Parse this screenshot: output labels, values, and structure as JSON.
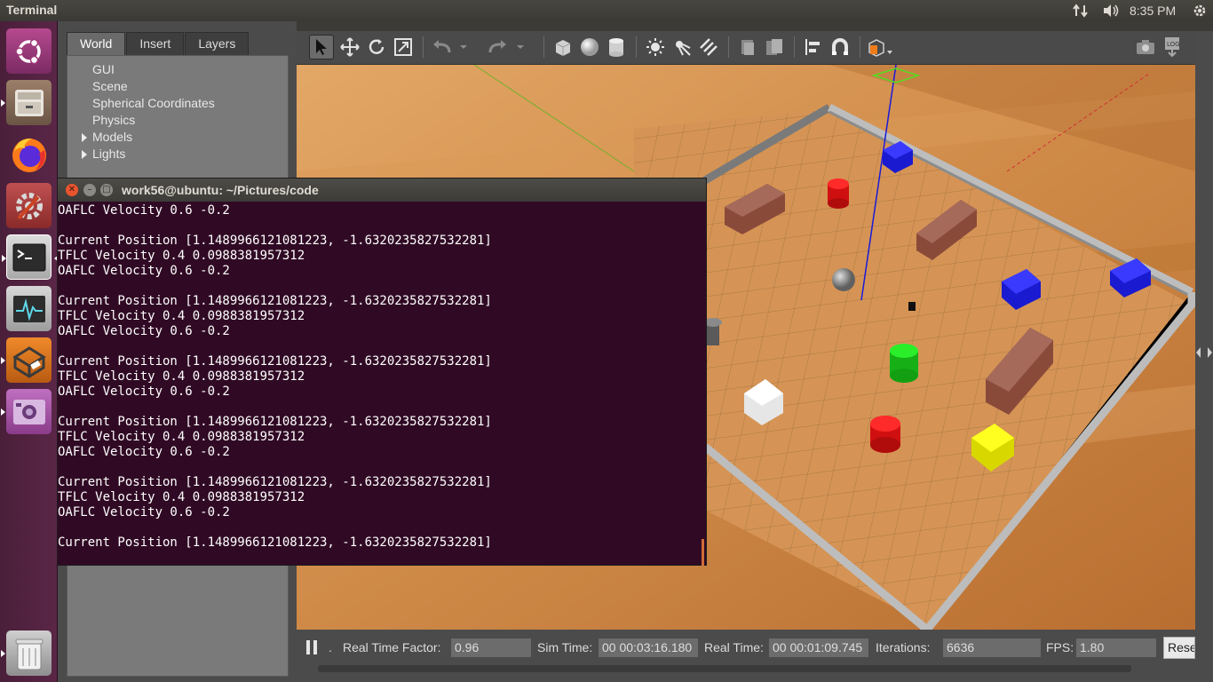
{
  "top_panel": {
    "title": "Terminal",
    "clock": "8:35 PM",
    "indicators": [
      "network-icon",
      "volume-icon",
      "settings-gear-icon"
    ]
  },
  "launcher": {
    "items": [
      {
        "name": "ubuntu-dash",
        "icon": "ubuntu-logo-icon"
      },
      {
        "name": "files",
        "icon": "file-cabinet-icon"
      },
      {
        "name": "firefox",
        "icon": "firefox-icon"
      },
      {
        "name": "system-settings",
        "icon": "settings-wrench-icon"
      },
      {
        "name": "terminal",
        "icon": "terminal-icon"
      },
      {
        "name": "system-monitor",
        "icon": "system-monitor-icon"
      },
      {
        "name": "gazebo",
        "icon": "gazebo-icon"
      },
      {
        "name": "screenshot",
        "icon": "camera-app-icon"
      },
      {
        "name": "trash",
        "icon": "trash-icon"
      }
    ]
  },
  "gazebo": {
    "tabs": [
      "World",
      "Insert",
      "Layers"
    ],
    "active_tab": "World",
    "tree": [
      {
        "label": "GUI",
        "expandable": false
      },
      {
        "label": "Scene",
        "expandable": false
      },
      {
        "label": "Spherical Coordinates",
        "expandable": false
      },
      {
        "label": "Physics",
        "expandable": false
      },
      {
        "label": "Models",
        "expandable": true
      },
      {
        "label": "Lights",
        "expandable": true
      }
    ],
    "status": {
      "real_time_factor_label": "Real Time Factor:",
      "real_time_factor": "0.96",
      "sim_time_label": "Sim Time:",
      "sim_time": "00 00:03:16.180",
      "real_time_label": "Real Time:",
      "real_time": "00 00:01:09.745",
      "iterations_label": "Iterations:",
      "iterations": "6636",
      "fps_label": "FPS:",
      "fps": "1.80",
      "reset_label": "Reset",
      "step_label": "."
    }
  },
  "terminal": {
    "title": "work56@ubuntu: ~/Pictures/code",
    "lines": [
      "OAFLC Velocity 0.6 -0.2",
      "",
      "Current Position [1.1489966121081223, -1.6320235827532281]",
      "TFLC Velocity 0.4 0.0988381957312",
      "OAFLC Velocity 0.6 -0.2",
      "",
      "Current Position [1.1489966121081223, -1.6320235827532281]",
      "TFLC Velocity 0.4 0.0988381957312",
      "OAFLC Velocity 0.6 -0.2",
      "",
      "Current Position [1.1489966121081223, -1.6320235827532281]",
      "TFLC Velocity 0.4 0.0988381957312",
      "OAFLC Velocity 0.6 -0.2",
      "",
      "Current Position [1.1489966121081223, -1.6320235827532281]",
      "TFLC Velocity 0.4 0.0988381957312",
      "OAFLC Velocity 0.6 -0.2",
      "",
      "Current Position [1.1489966121081223, -1.6320235827532281]",
      "TFLC Velocity 0.4 0.0988381957312",
      "OAFLC Velocity 0.6 -0.2",
      "",
      "Current Position [1.1489966121081223, -1.6320235827532281]"
    ]
  },
  "colors": {
    "terminal_bg": "#300a24",
    "launcher_bg": "#4a1f3a",
    "floor": "#c98a4a",
    "wall": "#bdbdbd"
  }
}
